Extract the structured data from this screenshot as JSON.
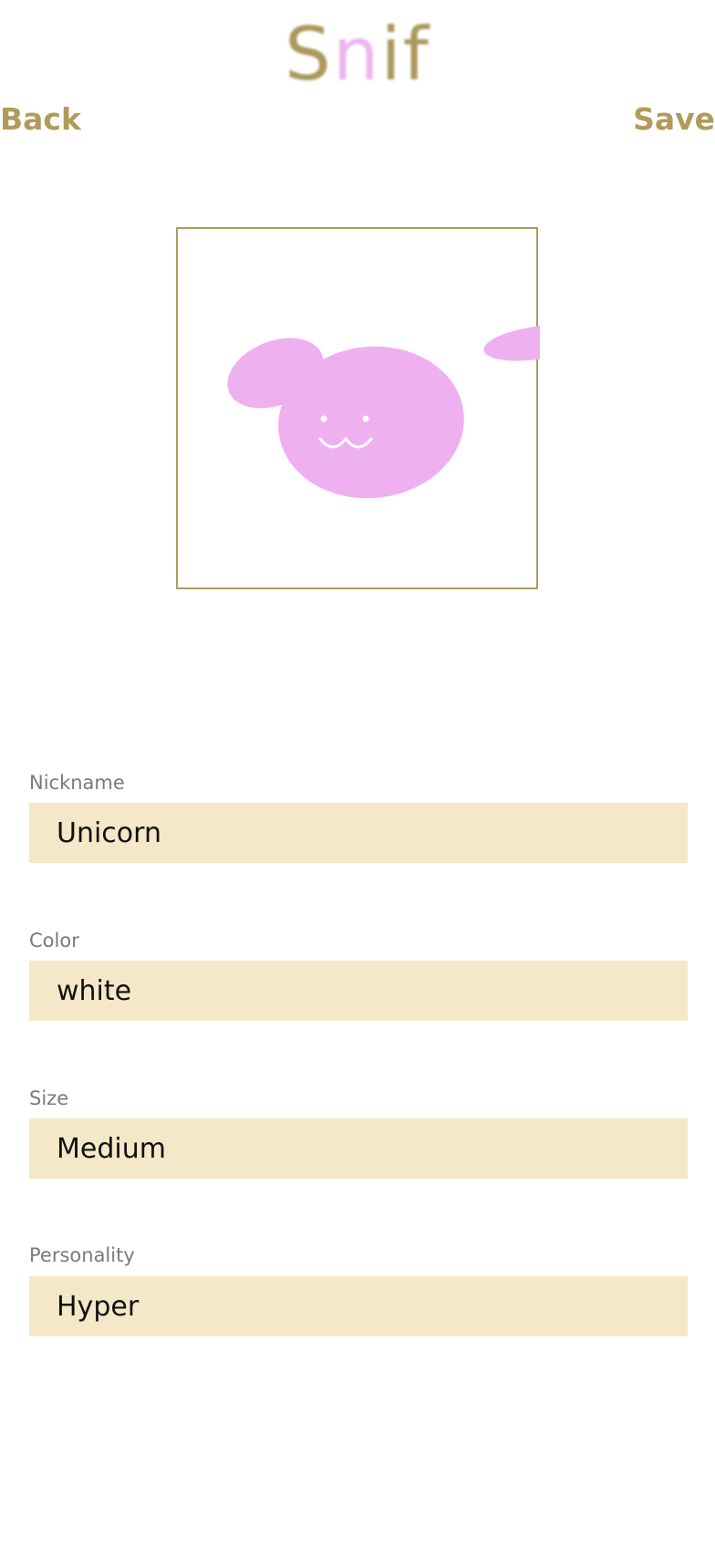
{
  "header": {
    "logo_first": "S",
    "logo_accent": "n",
    "logo_rest": "if",
    "back_label": "Back",
    "save_label": "Save"
  },
  "colors": {
    "gold": "#b09b5b",
    "field_background": "#f4e8c8",
    "pet_pink": "#efb0f0"
  },
  "photo": {
    "icon": "bunny-face-icon"
  },
  "form": {
    "nickname": {
      "label": "Nickname",
      "value": "Unicorn"
    },
    "color": {
      "label": "Color",
      "value": "white"
    },
    "size": {
      "label": "Size",
      "value": "Medium"
    },
    "personality": {
      "label": "Personality",
      "value": "Hyper"
    }
  }
}
